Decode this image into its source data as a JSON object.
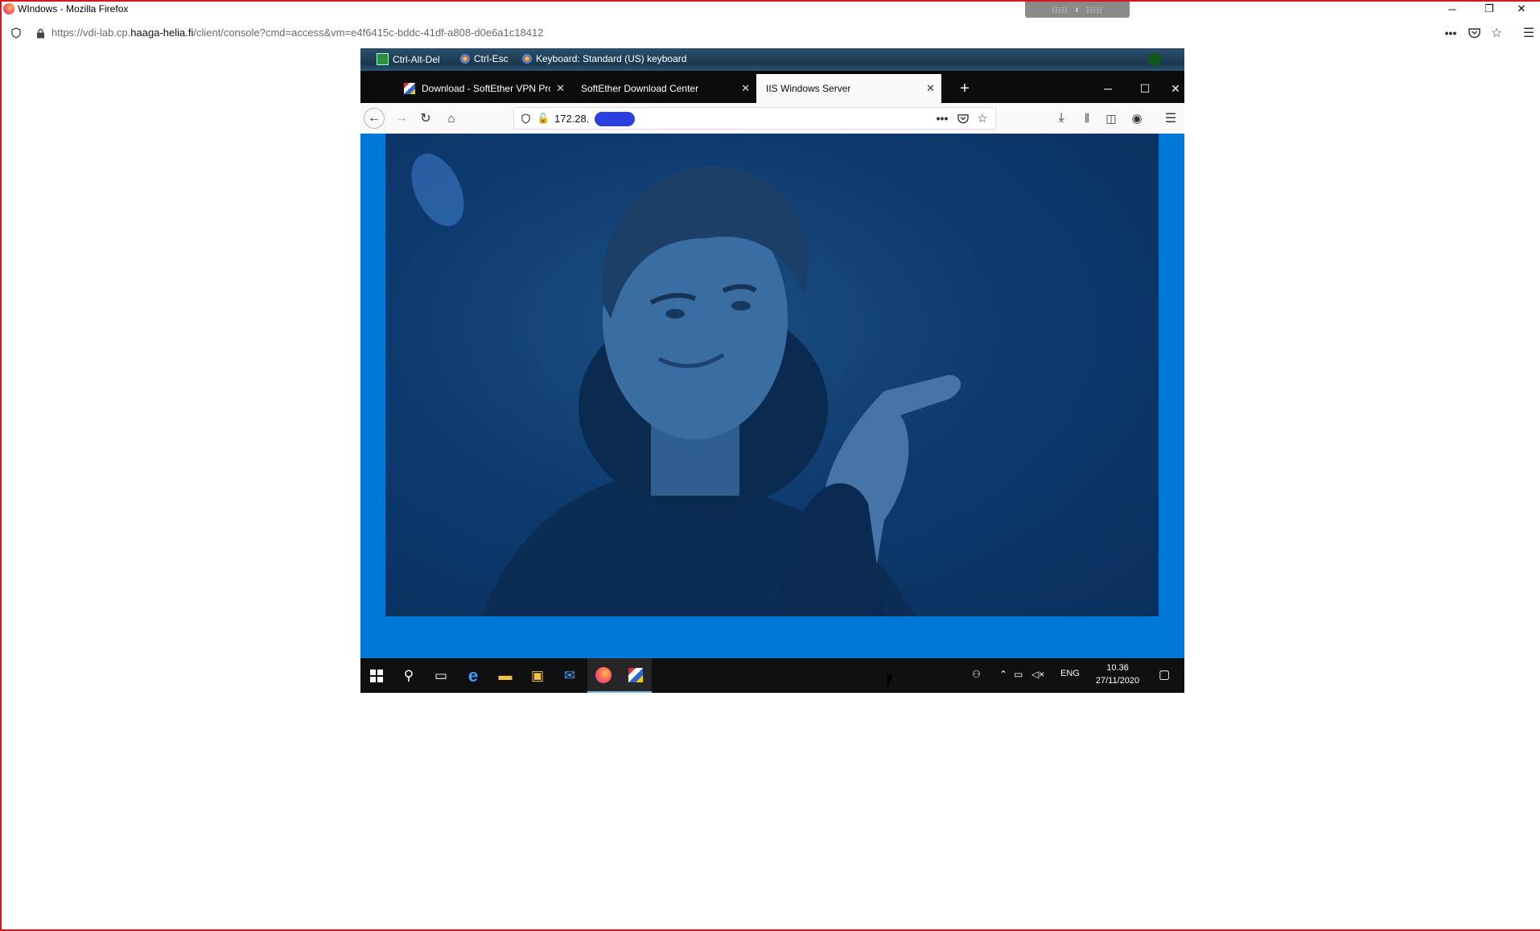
{
  "outer_window": {
    "title": "WIndows - Mozilla Firefox",
    "url_prefix": "https://vdi-lab.cp.",
    "url_domain": "haaga-helia.fi",
    "url_rest": "/client/console?cmd=access&vm=e4f6415c-bddc-41df-a808-d0e6a1c18412",
    "minimize": "─",
    "restore": "❐",
    "close": "✕",
    "handle_glyphs": "⁞⁞⁞⁞⁞ ⬇ ⁞⁞⁞⁞⁞"
  },
  "remote_toolbar": {
    "ctrl_alt_del": "Ctrl-Alt-Del",
    "ctrl_esc": "Ctrl-Esc",
    "keyboard": "Keyboard: Standard (US) keyboard"
  },
  "inner_browser": {
    "tabs": [
      {
        "label": "Download - SoftEther VPN Proj"
      },
      {
        "label": "SoftEther Download Center"
      },
      {
        "label": "IIS Windows Server"
      }
    ],
    "address": "172.28.",
    "new_tab": "+"
  },
  "taskbar": {
    "language": "ENG",
    "time": "10.36",
    "date": "27/11/2020"
  },
  "icons": {
    "outer_shield": "shield-icon",
    "lock": "lock-icon",
    "colors": {
      "accent_red": "#d81818",
      "desktop_blue": "#0078d7",
      "taskbar": "#101010"
    }
  }
}
